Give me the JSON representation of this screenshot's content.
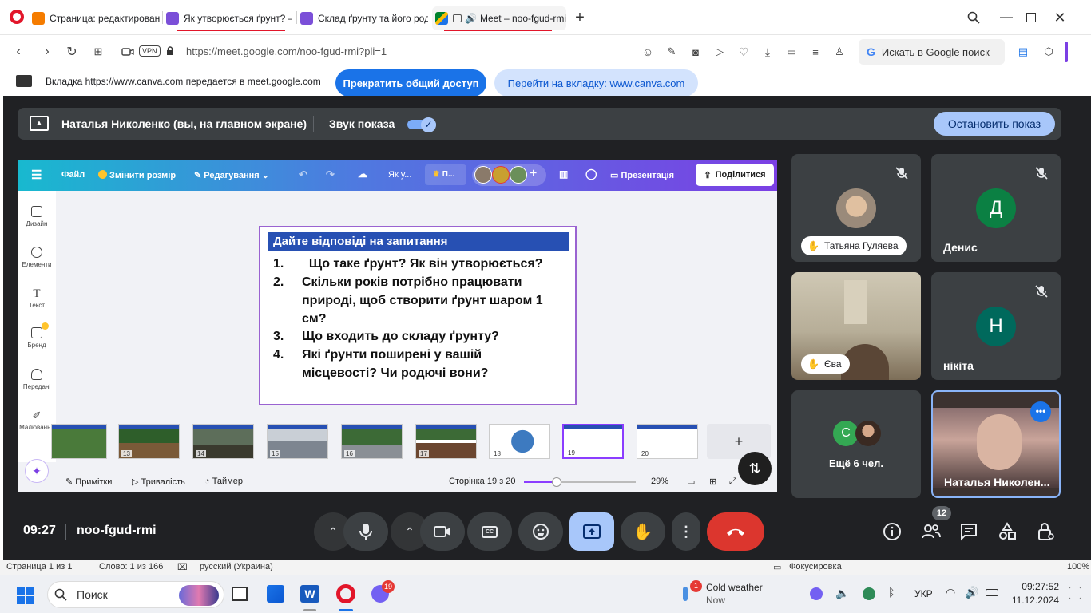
{
  "browser": {
    "tabs": [
      {
        "title": "Страница: редактирован"
      },
      {
        "title": "Як утворюється ґрунт? –"
      },
      {
        "title": "Склад ґрунту та його род"
      },
      {
        "title": "Meet – noo-fgud-rmi"
      }
    ],
    "url": "https://meet.google.com/noo-fgud-rmi?pli=1",
    "vpn_label": "VPN",
    "search_label": "Искать в Google поиск"
  },
  "share_notice": {
    "text": "Вкладка https://www.canva.com передается в meet.google.com",
    "stop_label": "Прекратить общий доступ",
    "goto_label": "Перейти на вкладку: www.canva.com"
  },
  "meet": {
    "presenting_text": "Наталья Николенко (вы, на главном экране)",
    "sound_label": "Звук показа",
    "stop_show_label": "Остановить показ",
    "time": "09:27",
    "code": "noo-fgud-rmi",
    "people_count": "12"
  },
  "canva": {
    "menu": {
      "file": "Файл",
      "resize": "Змінити розмір",
      "edit": "Редагування",
      "doc_title": "Як у...",
      "pro": "П...",
      "present": "Презентація",
      "share": "Поділитися"
    },
    "sidebar": [
      "Дизайн",
      "Елементи",
      "Текст",
      "Бренд",
      "Передані",
      "Малювання"
    ],
    "slide": {
      "heading": "Дайте відповіді на запитання",
      "questions": [
        {
          "n": "1.",
          "text": "  Що таке ґрунт? Як він утворюється?"
        },
        {
          "n": "2.",
          "text": "Скільки років потрібно працювати природі, щоб створити ґрунт шаром 1 см?"
        },
        {
          "n": "3.",
          "text": "Що входить до складу ґрунту?"
        },
        {
          "n": "4.",
          "text": "Які ґрунти поширені у вашій місцевості? Чи родючі вони?"
        }
      ]
    },
    "thumbnails": [
      "13",
      "14",
      "15",
      "16",
      "17",
      "18",
      "19",
      "20"
    ],
    "bottom": {
      "notes": "Примітки",
      "duration": "Тривалість",
      "timer": "Таймер",
      "page": "Сторінка 19 з 20",
      "zoom": "29%"
    }
  },
  "participants": [
    {
      "name": "Татьяна Гуляева",
      "muted": true
    },
    {
      "name": "Денис",
      "initial": "Д",
      "color": "#0b8043",
      "muted": true
    },
    {
      "name": "Єва",
      "muted": false
    },
    {
      "name": "нікіта",
      "initial": "Н",
      "color": "#00695c",
      "muted": true
    },
    {
      "name": "Ещё 6 чел.",
      "initial": "С",
      "color": "#34a853"
    },
    {
      "name": "Наталья Николен..."
    }
  ],
  "taskbar": {
    "search": "Поиск",
    "viber_badge": "19",
    "weather_title": "Cold weather",
    "weather_sub": "Now",
    "weather_badge": "1",
    "lang": "УКР",
    "clock_time": "09:27:52",
    "clock_date": "11.12.2024"
  },
  "behind_window": {
    "status": "Страница 1 из 1",
    "words": "Слово: 1 из 166",
    "lang": "русский (Украина)",
    "focus": "Фокусировка",
    "zoom": "100%"
  }
}
